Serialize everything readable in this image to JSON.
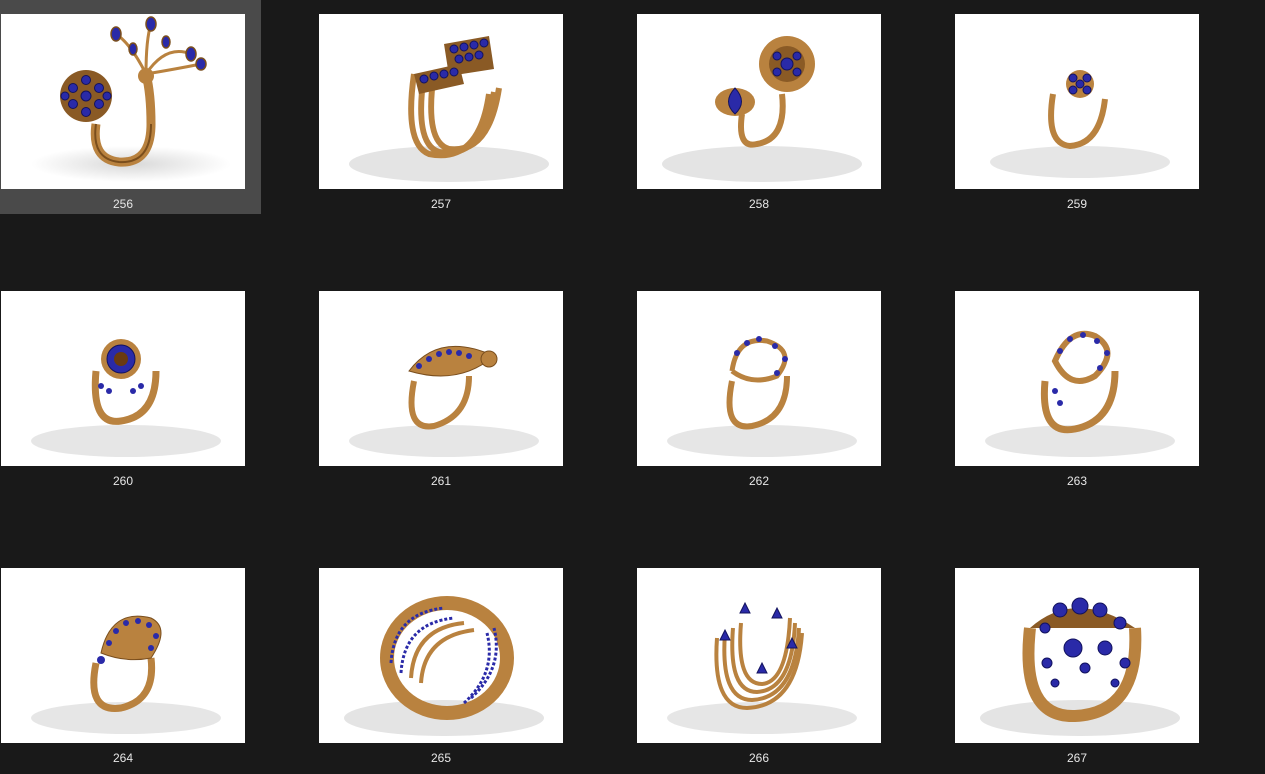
{
  "gallery": {
    "selected_index": 0,
    "colors": {
      "background": "#191919",
      "selection": "#4a4a4a",
      "thumb_bg": "#ffffff",
      "gold": "#b9823f",
      "gold_dark": "#7a4e1d",
      "gem": "#2a2aa8",
      "gem_dark": "#12125e",
      "caption": "#e6e6e6"
    },
    "items": [
      {
        "label": "256",
        "icon": "ring-flower-open-icon"
      },
      {
        "label": "257",
        "icon": "ring-multi-band-icon"
      },
      {
        "label": "258",
        "icon": "ring-flower-pear-icon"
      },
      {
        "label": "259",
        "icon": "ring-small-flower-icon"
      },
      {
        "label": "260",
        "icon": "ring-halo-icon"
      },
      {
        "label": "261",
        "icon": "ring-leaf-icon"
      },
      {
        "label": "262",
        "icon": "ring-swirl-icon"
      },
      {
        "label": "263",
        "icon": "ring-wave-pave-icon"
      },
      {
        "label": "264",
        "icon": "ring-fan-pave-icon"
      },
      {
        "label": "265",
        "icon": "ring-wide-band-icon"
      },
      {
        "label": "266",
        "icon": "ring-stacked-star-icon"
      },
      {
        "label": "267",
        "icon": "ring-floral-cluster-icon"
      }
    ]
  }
}
